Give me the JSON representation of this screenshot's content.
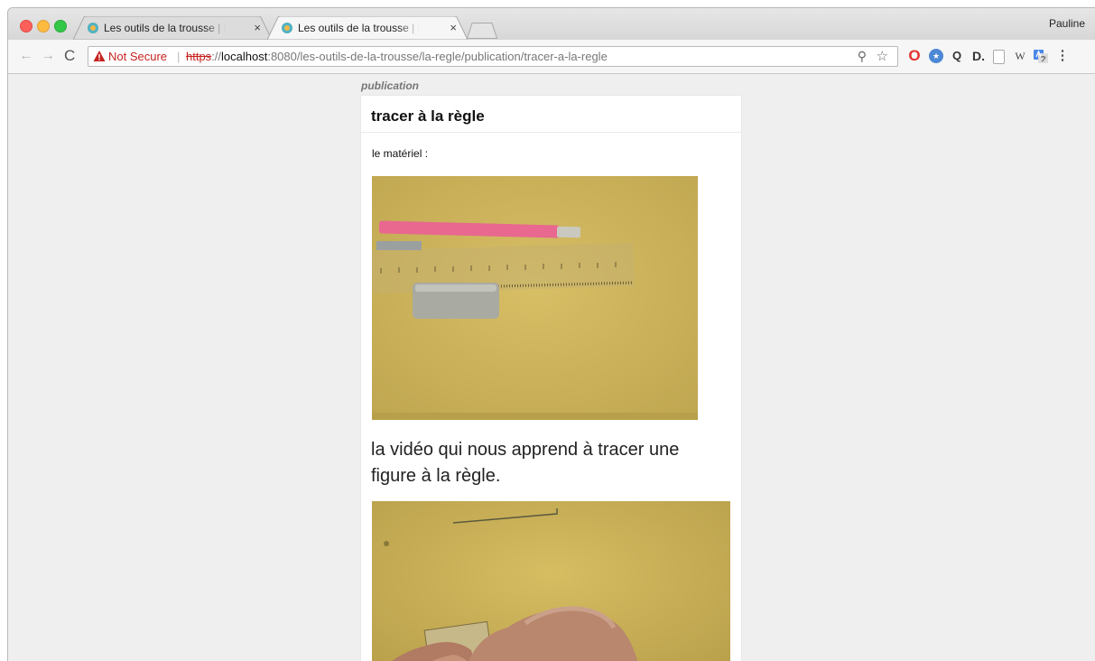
{
  "browser": {
    "tabs": [
      {
        "title": "Les outils de la trousse | la règle",
        "active": false
      },
      {
        "title": "Les outils de la trousse | la règle",
        "active": true
      }
    ],
    "close_glyph": "×",
    "profile_name": "Pauline",
    "nav": {
      "back": "←",
      "forward": "→",
      "reload": "C"
    },
    "address": {
      "security_label": "Not Secure",
      "separator": "|",
      "scheme": "https",
      "scheme_sep": "://",
      "host": "localhost",
      "path": ":8080/les-outils-de-la-trousse/la-regle/publication/tracer-a-la-regle"
    },
    "icons": {
      "zoom": "⚲",
      "bookmark": "☆",
      "extension_opera": "O",
      "extension_zoom": "Q",
      "extension_d": "D.",
      "extension_w": "W",
      "menu": "⋮"
    }
  },
  "page": {
    "breadcrumb": "publication",
    "title": "tracer à la règle",
    "intro": "le matériel :",
    "subtitle": "la vidéo qui nous apprend à tracer une figure à la règle."
  },
  "colors": {
    "photo_background": "#cfb75b",
    "danger": "#c5221f"
  }
}
